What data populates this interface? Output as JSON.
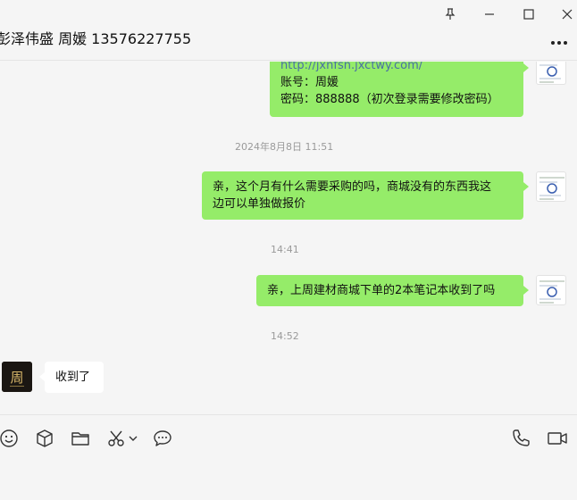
{
  "header": {
    "title": "彭泽伟盛 周媛 13576227755"
  },
  "messages": [
    {
      "side": "me",
      "lines": [
        "http://jxnfsn.jxctwy.com/",
        "账号：周媛",
        "密码：888888（初次登录需要修改密码）"
      ]
    },
    {
      "timestamp": "2024年8月8日 11:51"
    },
    {
      "side": "me",
      "lines": [
        "亲，这个月有什么需要采购的吗，商城没有的东西我这",
        "边可以单独做报价"
      ]
    },
    {
      "timestamp": "14:41"
    },
    {
      "side": "me",
      "lines": [
        "亲，上周建材商城下单的2本笔记本收到了吗"
      ]
    },
    {
      "timestamp": "14:52"
    },
    {
      "side": "them",
      "lines": [
        "收到了"
      ],
      "avatar_text": "周"
    }
  ],
  "toolbar": {
    "left_icons": [
      "emoji-icon",
      "package-icon",
      "folder-icon",
      "scissors-icon",
      "chevron-down-icon",
      "chat-bubble-icon"
    ],
    "right_icons": [
      "phone-icon",
      "video-call-icon"
    ]
  },
  "window_controls": [
    "pin-icon",
    "minimize-icon",
    "maximize-icon",
    "close-icon"
  ],
  "colors": {
    "my_bubble": "#95ec69",
    "their_bubble": "#ffffff",
    "background": "#f5f5f5",
    "link": "#4a6fa5"
  }
}
